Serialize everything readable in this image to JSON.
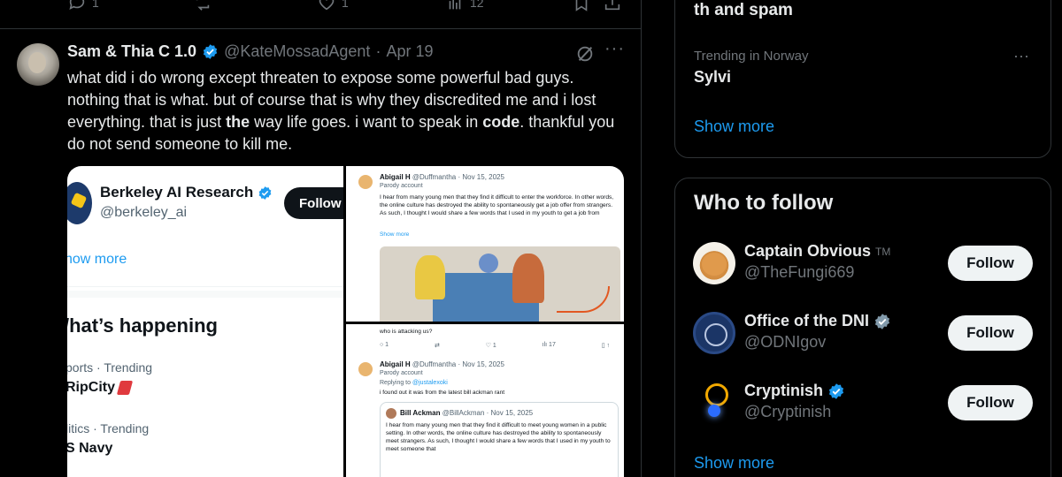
{
  "actionbar": {
    "replies": "1",
    "reposts": "",
    "likes": "1",
    "views": "12"
  },
  "post": {
    "author_name": "Sam & Thia C 1.0",
    "handle": "@KateMossadAgent",
    "date": "Apr 19",
    "more": "···",
    "text_1": "what did i do wrong except threaten to expose some powerful bad guys. nothing that is what. but of course that is why they discredited me and i lost everything. that is just ",
    "text_bold_1": "the",
    "text_2": " way life goes. i want to speak in ",
    "text_bold_2": "code",
    "text_3": ". thankful you do not send someone to kill me."
  },
  "media_left": {
    "account_name": "Berkeley AI Research",
    "account_handle": "@berkeley_ai",
    "follow_label": "Follow",
    "show_more": "how more",
    "heading": "/hat’s happening",
    "trends": [
      {
        "meta": "ports · Trending",
        "name": "RipCity"
      },
      {
        "meta": "litics · Trending",
        "name": "S Navy"
      }
    ]
  },
  "media_right_top": {
    "name": "Abigail H",
    "handle": "@Duffmantha · Nov 15, 2025",
    "parody": "Parody account",
    "text": "I hear from many young men that they find it difficult to enter the workforce. In other words, the online culture has destroyed the ability to spontaneously get a job offer from strangers. As such, I thought I would share a few words that I used in my youth to get a job from",
    "show_more": "Show more"
  },
  "media_right_bottom": {
    "top_text": "who is attacking us?",
    "action_views": "17",
    "name": "Abigail H",
    "handle": "@Duffmantha · Nov 15, 2025",
    "parody": "Parody account",
    "replying_to": "Replying to",
    "replying_handle": "@justalexoki",
    "reply_text": "i found out it was from the latest bill ackman rant",
    "quote_name": "Bill Ackman",
    "quote_handle": "@BillAckman · Nov 15, 2025",
    "quote_text": "I hear from many young men that they find it difficult to meet young women in a public setting. In other words, the online culture has destroyed the ability to spontaneously meet strangers. As such, I thought I would share a few words that I used in my youth to meet someone that"
  },
  "sidebar": {
    "trends_card": {
      "continued_text": "th and spam",
      "trend_location": "Trending in Norway",
      "trend_name": "Sylvi",
      "more": "···",
      "show_more": "Show more"
    },
    "who_to_follow": {
      "title": "Who to follow",
      "accounts": [
        {
          "name": "Captain Obvious",
          "suffix": "TM",
          "handle": "@TheFungi669",
          "follow": "Follow"
        },
        {
          "name": "Office of the DNI",
          "handle": "@ODNIgov",
          "follow": "Follow"
        },
        {
          "name": "Cryptinish",
          "handle": "@Cryptinish",
          "follow": "Follow"
        }
      ],
      "show_more": "Show more"
    }
  },
  "colors": {
    "background": "#000000",
    "text": "#e7e9ea",
    "muted": "#71767b",
    "accent": "#1d9bf0",
    "border": "#2f3336",
    "verified": "#1d9bf0"
  }
}
